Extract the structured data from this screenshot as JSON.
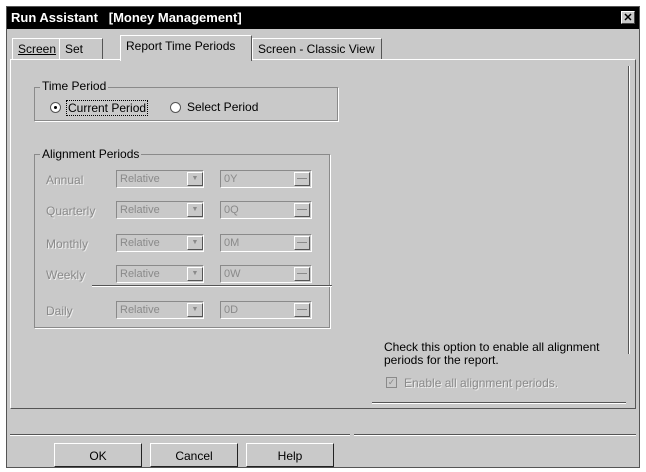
{
  "window": {
    "title": "Run Assistant   [Money Management]",
    "close_glyph": "✕"
  },
  "tabs": [
    {
      "label": "Screen"
    },
    {
      "label": "Set"
    },
    {
      "label": "Report Time Periods"
    },
    {
      "label": "Screen - Classic View"
    }
  ],
  "time_period": {
    "legend": "Time Period",
    "current_label": "Current Period",
    "select_label": "Select Period",
    "selected": "current"
  },
  "alignment": {
    "legend": "Alignment Periods",
    "rows": [
      {
        "label": "Annual",
        "mode": "Relative",
        "value": "0Y"
      },
      {
        "label": "Quarterly",
        "mode": "Relative",
        "value": "0Q"
      },
      {
        "label": "Monthly",
        "mode": "Relative",
        "value": "0M"
      },
      {
        "label": "Weekly",
        "mode": "Relative",
        "value": "0W"
      },
      {
        "label": "Daily",
        "mode": "Relative",
        "value": "0D"
      }
    ]
  },
  "help_text": "Check this option to enable all alignment periods for the report.",
  "enable_all": {
    "label": "Enable all alignment periods.",
    "checked": true
  },
  "buttons": {
    "ok": "OK",
    "cancel": "Cancel",
    "help": "Help"
  },
  "colors": {
    "face": "#c9c9c9",
    "title_bg": "#000000",
    "disabled_text": "#8a8a8a"
  }
}
